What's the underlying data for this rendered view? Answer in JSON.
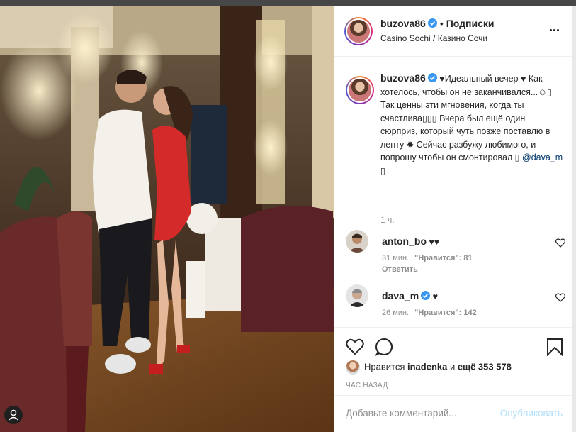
{
  "post": {
    "username": "buzova86",
    "follow_separator": "•",
    "follow_label": "Подписки",
    "location": "Casino Sochi / Казино Сочи"
  },
  "caption": {
    "username": "buzova86",
    "text": "♥Идеальный вечер ♥ Как хотелось, чтобы он не заканчивался...☺︎▯ Так ценны эти мгновения, когда ты счастлива▯▯▯ Вчера был ещё один сюрприз, который чуть позже поставлю в ленту ✹ Сейчас разбужу любимого, и попрошу чтобы он смонтировал ▯",
    "mention": "@dava_m",
    "mention_suffix": " ▯",
    "time": "1 ч."
  },
  "comments": [
    {
      "username": "anton_bo",
      "text": "♥♥",
      "time": "31 мин.",
      "likes": "\"Нравится\": 81",
      "reply": "Ответить"
    },
    {
      "username": "dava_m",
      "text": "♥",
      "time": "26 мин.",
      "likes": "\"Нравится\": 142"
    }
  ],
  "likes_row": {
    "prefix": "Нравится",
    "user": "inadenka",
    "middle": "и",
    "count": "ещё 353 578"
  },
  "timestamp": "ЧАС НАЗАД",
  "add_comment": {
    "placeholder": "Добавьте комментарий...",
    "post_button": "Опубликовать"
  },
  "colors": {
    "verified": "#3897f0",
    "link": "#00376b",
    "post_disabled": "#b2dffc",
    "muted": "#8e8e8e"
  }
}
